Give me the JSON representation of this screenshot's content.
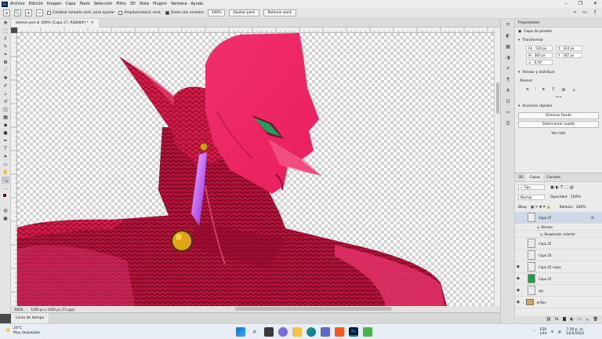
{
  "menubar": {
    "logo": "Ps",
    "items": [
      "Archivo",
      "Edición",
      "Imagen",
      "Capa",
      "Texto",
      "Selección",
      "Filtro",
      "3D",
      "Vista",
      "Plugins",
      "Ventana",
      "Ayuda"
    ]
  },
  "options": {
    "resize_windows": "Cambiar tamaño vent. para ajustar",
    "zoom_all": "Ampliar/reducir vent.",
    "scrubby_zoom": "Zoom con arrastre",
    "zoom_value": "100%",
    "fit_screen": "Ajustar pant.",
    "fill_screen": "Rellenar pant."
  },
  "document": {
    "tab_title": "demon.psd al 300% (Capa 27, RGB/8#) *",
    "zoom": "300%",
    "doc_info": "1200 px x 1200 px (72 ppp)"
  },
  "timeline": {
    "label": "Línea de tiempo"
  },
  "properties": {
    "tab": "Propiedades",
    "layer_kind": "Capa de píxeles",
    "transform_title": "Transformar",
    "w": "524 px",
    "h": "382 px",
    "x": "424 px",
    "y": "187 px",
    "angle": "0,00°",
    "align_title": "Alinear y distribuir",
    "align_label": "Alinear:",
    "quick_title": "Acciones rápidas",
    "remove_bg": "Eliminar fondo",
    "select_subject": "Seleccionar sujeto",
    "more": "Ver más"
  },
  "layers_panel": {
    "tabs": [
      "3D",
      "Capas",
      "Canales"
    ],
    "filter": "Tipo",
    "blend_mode": "Normal",
    "opacity_label": "Opacidad:",
    "opacity": "100%",
    "lock_label": "Bloq.:",
    "fill_label": "Relleno:",
    "fill": "100%",
    "layers": [
      {
        "name": "Capa 27",
        "visible": false,
        "selected": true,
        "fx": true
      },
      {
        "name": "Efectos",
        "visible": false,
        "sub": true
      },
      {
        "name": "Resplandor anterior",
        "visible": false,
        "sub": true
      },
      {
        "name": "Capa 25",
        "visible": false
      },
      {
        "name": "Capa 24",
        "visible": false
      },
      {
        "name": "Capa 22 copia",
        "visible": true
      },
      {
        "name": "Capa 22",
        "visible": true
      },
      {
        "name": "ojo.",
        "visible": true
      },
      {
        "name": "orillos",
        "visible": true,
        "folder": true
      }
    ]
  },
  "taskbar": {
    "temp": "24°C",
    "weather": "Muy despejado",
    "lang_top": "ESP",
    "lang_bottom": "LAA",
    "time": "7:39 p. m.",
    "date": "14/5/2022"
  },
  "colors": {
    "foreground": "#6b0000",
    "background": "#ffffff",
    "accent": "#001e36"
  }
}
